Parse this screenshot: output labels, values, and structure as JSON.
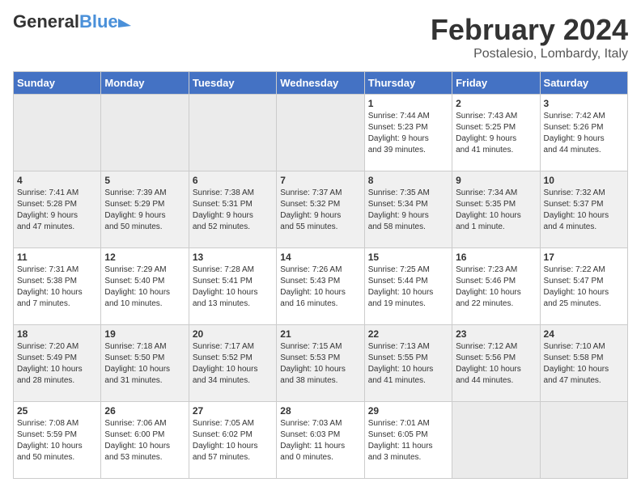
{
  "header": {
    "logo_text_general": "General",
    "logo_text_blue": "Blue",
    "month_year": "February 2024",
    "location": "Postalesio, Lombardy, Italy"
  },
  "days_of_week": [
    "Sunday",
    "Monday",
    "Tuesday",
    "Wednesday",
    "Thursday",
    "Friday",
    "Saturday"
  ],
  "weeks": [
    [
      {
        "date": "",
        "info": ""
      },
      {
        "date": "",
        "info": ""
      },
      {
        "date": "",
        "info": ""
      },
      {
        "date": "",
        "info": ""
      },
      {
        "date": "1",
        "info": "Sunrise: 7:44 AM\nSunset: 5:23 PM\nDaylight: 9 hours\nand 39 minutes."
      },
      {
        "date": "2",
        "info": "Sunrise: 7:43 AM\nSunset: 5:25 PM\nDaylight: 9 hours\nand 41 minutes."
      },
      {
        "date": "3",
        "info": "Sunrise: 7:42 AM\nSunset: 5:26 PM\nDaylight: 9 hours\nand 44 minutes."
      }
    ],
    [
      {
        "date": "4",
        "info": "Sunrise: 7:41 AM\nSunset: 5:28 PM\nDaylight: 9 hours\nand 47 minutes."
      },
      {
        "date": "5",
        "info": "Sunrise: 7:39 AM\nSunset: 5:29 PM\nDaylight: 9 hours\nand 50 minutes."
      },
      {
        "date": "6",
        "info": "Sunrise: 7:38 AM\nSunset: 5:31 PM\nDaylight: 9 hours\nand 52 minutes."
      },
      {
        "date": "7",
        "info": "Sunrise: 7:37 AM\nSunset: 5:32 PM\nDaylight: 9 hours\nand 55 minutes."
      },
      {
        "date": "8",
        "info": "Sunrise: 7:35 AM\nSunset: 5:34 PM\nDaylight: 9 hours\nand 58 minutes."
      },
      {
        "date": "9",
        "info": "Sunrise: 7:34 AM\nSunset: 5:35 PM\nDaylight: 10 hours\nand 1 minute."
      },
      {
        "date": "10",
        "info": "Sunrise: 7:32 AM\nSunset: 5:37 PM\nDaylight: 10 hours\nand 4 minutes."
      }
    ],
    [
      {
        "date": "11",
        "info": "Sunrise: 7:31 AM\nSunset: 5:38 PM\nDaylight: 10 hours\nand 7 minutes."
      },
      {
        "date": "12",
        "info": "Sunrise: 7:29 AM\nSunset: 5:40 PM\nDaylight: 10 hours\nand 10 minutes."
      },
      {
        "date": "13",
        "info": "Sunrise: 7:28 AM\nSunset: 5:41 PM\nDaylight: 10 hours\nand 13 minutes."
      },
      {
        "date": "14",
        "info": "Sunrise: 7:26 AM\nSunset: 5:43 PM\nDaylight: 10 hours\nand 16 minutes."
      },
      {
        "date": "15",
        "info": "Sunrise: 7:25 AM\nSunset: 5:44 PM\nDaylight: 10 hours\nand 19 minutes."
      },
      {
        "date": "16",
        "info": "Sunrise: 7:23 AM\nSunset: 5:46 PM\nDaylight: 10 hours\nand 22 minutes."
      },
      {
        "date": "17",
        "info": "Sunrise: 7:22 AM\nSunset: 5:47 PM\nDaylight: 10 hours\nand 25 minutes."
      }
    ],
    [
      {
        "date": "18",
        "info": "Sunrise: 7:20 AM\nSunset: 5:49 PM\nDaylight: 10 hours\nand 28 minutes."
      },
      {
        "date": "19",
        "info": "Sunrise: 7:18 AM\nSunset: 5:50 PM\nDaylight: 10 hours\nand 31 minutes."
      },
      {
        "date": "20",
        "info": "Sunrise: 7:17 AM\nSunset: 5:52 PM\nDaylight: 10 hours\nand 34 minutes."
      },
      {
        "date": "21",
        "info": "Sunrise: 7:15 AM\nSunset: 5:53 PM\nDaylight: 10 hours\nand 38 minutes."
      },
      {
        "date": "22",
        "info": "Sunrise: 7:13 AM\nSunset: 5:55 PM\nDaylight: 10 hours\nand 41 minutes."
      },
      {
        "date": "23",
        "info": "Sunrise: 7:12 AM\nSunset: 5:56 PM\nDaylight: 10 hours\nand 44 minutes."
      },
      {
        "date": "24",
        "info": "Sunrise: 7:10 AM\nSunset: 5:58 PM\nDaylight: 10 hours\nand 47 minutes."
      }
    ],
    [
      {
        "date": "25",
        "info": "Sunrise: 7:08 AM\nSunset: 5:59 PM\nDaylight: 10 hours\nand 50 minutes."
      },
      {
        "date": "26",
        "info": "Sunrise: 7:06 AM\nSunset: 6:00 PM\nDaylight: 10 hours\nand 53 minutes."
      },
      {
        "date": "27",
        "info": "Sunrise: 7:05 AM\nSunset: 6:02 PM\nDaylight: 10 hours\nand 57 minutes."
      },
      {
        "date": "28",
        "info": "Sunrise: 7:03 AM\nSunset: 6:03 PM\nDaylight: 11 hours\nand 0 minutes."
      },
      {
        "date": "29",
        "info": "Sunrise: 7:01 AM\nSunset: 6:05 PM\nDaylight: 11 hours\nand 3 minutes."
      },
      {
        "date": "",
        "info": ""
      },
      {
        "date": "",
        "info": ""
      }
    ]
  ]
}
